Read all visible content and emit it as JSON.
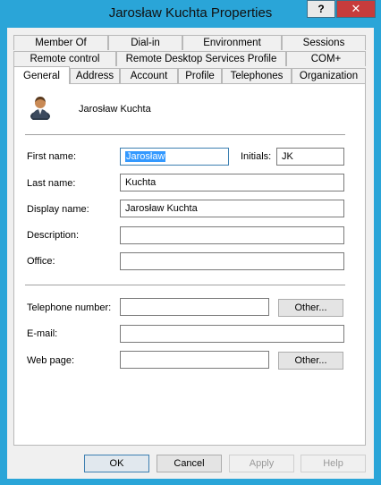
{
  "window": {
    "title": "Jarosław Kuchta Properties",
    "help_label": "?",
    "close_label": "✕"
  },
  "tabs": {
    "row1": [
      "Member Of",
      "Dial-in",
      "Environment",
      "Sessions"
    ],
    "row2": [
      "Remote control",
      "Remote Desktop Services Profile",
      "COM+"
    ],
    "row3": [
      "General",
      "Address",
      "Account",
      "Profile",
      "Telephones",
      "Organization"
    ],
    "active": "General"
  },
  "general": {
    "user_name": "Jarosław Kuchta",
    "first_name_label": "First name:",
    "first_name_value": "Jarosław",
    "initials_label": "Initials:",
    "initials_value": "JK",
    "last_name_label": "Last name:",
    "last_name_value": "Kuchta",
    "display_name_label": "Display name:",
    "display_name_value": "Jarosław Kuchta",
    "description_label": "Description:",
    "description_value": "",
    "office_label": "Office:",
    "office_value": "",
    "telephone_label": "Telephone number:",
    "telephone_value": "",
    "email_label": "E-mail:",
    "email_value": "",
    "webpage_label": "Web page:",
    "webpage_value": "",
    "other_label": "Other..."
  },
  "footer": {
    "ok": "OK",
    "cancel": "Cancel",
    "apply": "Apply",
    "help": "Help"
  },
  "colors": {
    "frame": "#2aa5d8",
    "close": "#c73c3c",
    "selection": "#3399ff"
  },
  "icons": {
    "user": "user-avatar-icon"
  }
}
